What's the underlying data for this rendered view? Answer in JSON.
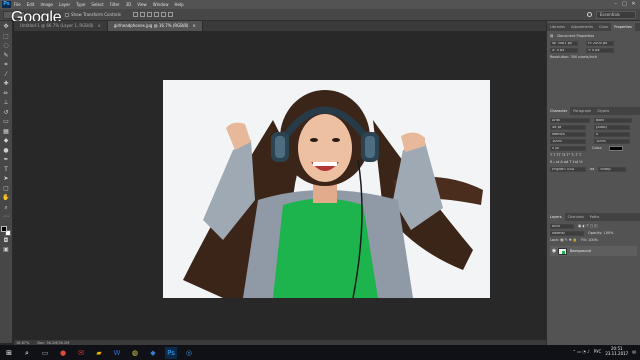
{
  "app": {
    "watermark": "Google",
    "logo": "Ps"
  },
  "menu": [
    "File",
    "Edit",
    "Image",
    "Layer",
    "Type",
    "Select",
    "Filter",
    "3D",
    "View",
    "Window",
    "Help"
  ],
  "window_controls": [
    "–",
    "□",
    "✕"
  ],
  "options": {
    "transform_label": "Show Transform Controls",
    "workspace": "Essentials"
  },
  "tabs": [
    {
      "label": "Untitled-1 @ 66.7% (Layer 1, RGB/8)",
      "active": false
    },
    {
      "label": "girlheadphones.jpg @ 16.7% (RGB/8)",
      "active": true
    }
  ],
  "status": {
    "zoom": "16.67%",
    "doc": "Doc: 36.2M/36.2M"
  },
  "properties_panel": {
    "tabs": [
      "Libraries",
      "Adjustments",
      "Color",
      "Properties"
    ],
    "title": "Document Properties",
    "w": "W: 3081 px",
    "h": "H: 2000 px",
    "x": "X: 0 px",
    "y": "Y: 0 px",
    "resolution": "Resolution: 300 pixels/inch"
  },
  "character_panel": {
    "tabs": [
      "Character",
      "Paragraph",
      "Glyphs"
    ],
    "font_family": "Arial",
    "font_style": "Bold",
    "size": "48 pt",
    "leading": "(Auto)",
    "kerning": "Metrics",
    "tracking": "0",
    "v_scale": "100%",
    "h_scale": "100%",
    "baseline": "0 pt",
    "color_label": "Color:",
    "language": "English: USA",
    "aa": "aa",
    "aa_value": "Sharp"
  },
  "layers_panel": {
    "tabs": [
      "Layers",
      "Channels",
      "Paths"
    ],
    "kind": "Kind",
    "blend": "Normal",
    "opacity": "Opacity: 100%",
    "fill": "Fill: 100%",
    "layer_name": "Background"
  },
  "taskbar": {
    "tray_lang": "РУС",
    "time": "20:51",
    "date": "23.11.2017"
  },
  "colors": {
    "bg": "#282828",
    "panel": "#535353",
    "photo_bg": "#f2f4f5",
    "shirt": "#1db34d"
  }
}
